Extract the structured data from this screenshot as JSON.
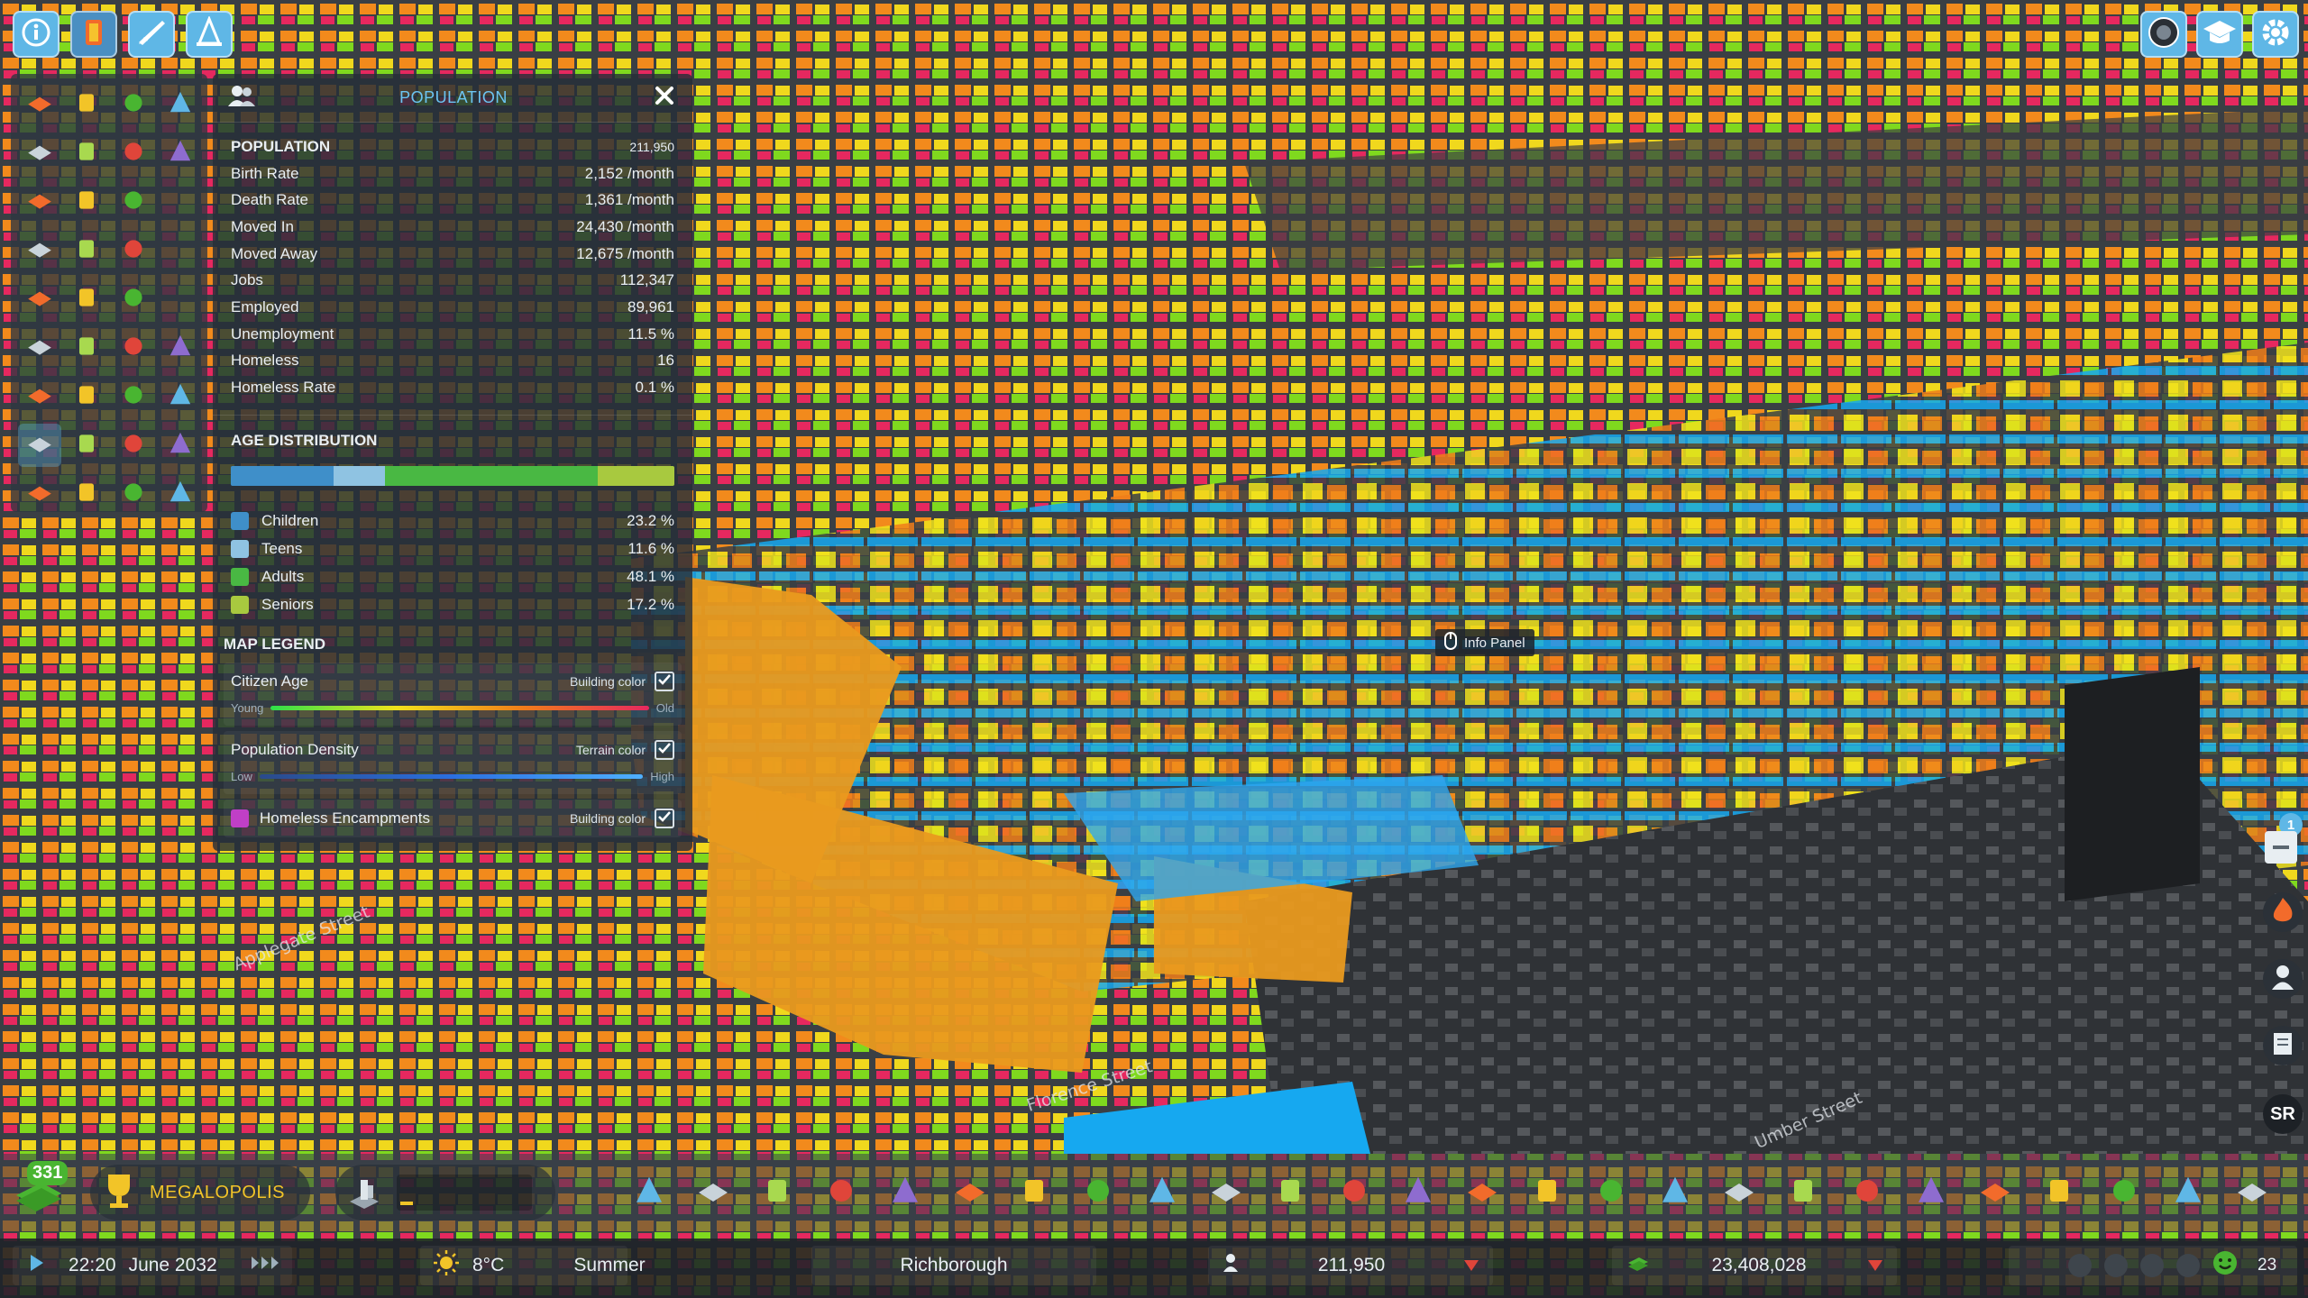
{
  "panel": {
    "title": "POPULATION",
    "stats_header": {
      "label": "POPULATION",
      "value": "211,950"
    },
    "stats": [
      {
        "label": "Birth Rate",
        "value": "2,152 /month"
      },
      {
        "label": "Death Rate",
        "value": "1,361 /month"
      },
      {
        "label": "Moved In",
        "value": "24,430 /month"
      },
      {
        "label": "Moved Away",
        "value": "12,675 /month"
      },
      {
        "label": "Jobs",
        "value": "112,347"
      },
      {
        "label": "Employed",
        "value": "89,961"
      },
      {
        "label": "Unemployment",
        "value": "11.5 %"
      },
      {
        "label": "Homeless",
        "value": "16"
      },
      {
        "label": "Homeless Rate",
        "value": "0.1 %"
      }
    ],
    "age_distribution": {
      "title": "AGE DISTRIBUTION",
      "groups": [
        {
          "label": "Children",
          "value": "23.2 %",
          "percent": 23.2,
          "color": "#3f8fc9"
        },
        {
          "label": "Teens",
          "value": "11.6 %",
          "percent": 11.6,
          "color": "#8fc3e2"
        },
        {
          "label": "Adults",
          "value": "48.1 %",
          "percent": 48.1,
          "color": "#49b843"
        },
        {
          "label": "Seniors",
          "value": "17.2 %",
          "percent": 17.2,
          "color": "#a8c93f"
        }
      ]
    },
    "legend": {
      "title": "MAP LEGEND",
      "items": [
        {
          "label": "Citizen Age",
          "kind": "Building color",
          "low": "Young",
          "high": "Old"
        },
        {
          "label": "Population Density",
          "kind": "Terrain color",
          "low": "Low",
          "high": "High"
        },
        {
          "label": "Homeless Encampments",
          "kind": "Building color",
          "swatch": "#c03fc6"
        }
      ]
    }
  },
  "map": {
    "tooltip": "Info Panel",
    "streets": [
      "Applegate Street",
      "Florence Street",
      "Umber Street"
    ]
  },
  "side": {
    "badge": "1",
    "sr_label": "SR"
  },
  "bottom": {
    "milestone_count": "331",
    "milestone_name": "MEGALOPOLIS"
  },
  "status": {
    "time": "22:20",
    "date": "June 2032",
    "temperature": "8°C",
    "season": "Summer",
    "city_name": "Richborough",
    "population": "211,950",
    "money": "23,408,028",
    "happiness": "23"
  },
  "icons": {
    "top_left": [
      "info-icon",
      "progression-icon",
      "economy-icon",
      "traffic-cone-icon"
    ],
    "top_right": [
      "photo-mode-icon",
      "tutorial-icon",
      "settings-icon"
    ],
    "infoviews": [
      "roads-icon",
      "electricity-grid-icon",
      "electricity-icon",
      "water-icon",
      "fire-icon",
      "recycling-icon",
      "health-icon",
      "pipe-icon",
      "police-icon",
      "building-icon",
      "education-icon",
      "",
      "transport-icon",
      "mail-icon",
      "telecom-icon",
      "",
      "parks-icon",
      "sewage-icon",
      "wand-icon",
      "",
      "residential-icon",
      "commercial-icon",
      "industrial-icon",
      "office-icon",
      "resources-icon",
      "land-value-icon",
      "signature-icon",
      "forest-icon",
      "population-icon",
      "happiness-icon",
      "tourism-icon",
      "noise-icon",
      "pollution-icon",
      "ground-pollution-icon",
      "noise-pollution-icon",
      "wind-icon"
    ],
    "tools": [
      "zoning-icon",
      "area-icon",
      "landscaping-icon",
      "road-icon",
      "electricity-icon",
      "water-icon",
      "fire-icon",
      "recycling-icon",
      "education-icon",
      "health-icon",
      "police-icon",
      "transport-icon",
      "parks-icon",
      "telecom-icon",
      "tree-icon",
      "shovel-icon",
      "construction-icon",
      "districts-icon",
      "map-icon",
      "landmark-icon",
      "terrain-icon",
      "surveyor-icon",
      "pencil-icon",
      "magnifier-icon",
      "move-icon",
      "camera-icon"
    ]
  },
  "colors": {
    "accent": "#5fb7e6",
    "money_green": "#49b531",
    "milestone_gold": "#f2c428",
    "negative_red": "#e0453a"
  }
}
